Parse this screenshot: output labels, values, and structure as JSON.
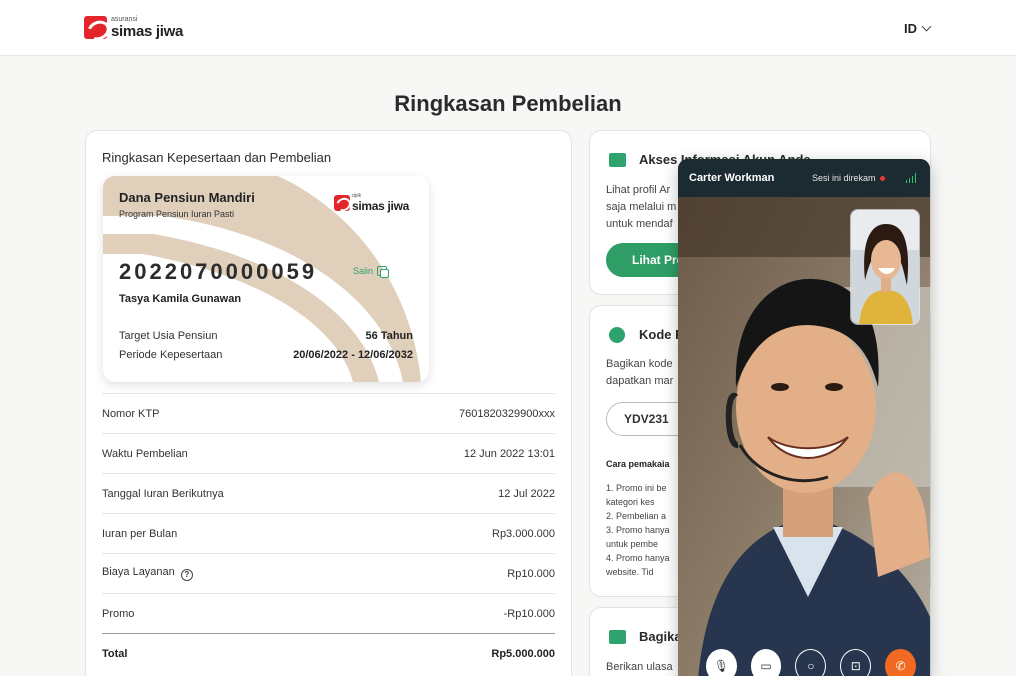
{
  "header": {
    "logo_sub": "asuransi",
    "logo_main": "simas jiwa",
    "language": "ID"
  },
  "page_title": "Ringkasan Pembelian",
  "summary": {
    "heading": "Ringkasan Kepesertaan dan Pembelian",
    "card": {
      "product_name": "Dana Pensiun Mandiri",
      "program": "Program Pensiun Iuran Pasti",
      "logo_sub": "dplk",
      "logo_main": "simas jiwa",
      "number": "2022070000059",
      "copy_label": "Salin",
      "holder": "Tasya Kamila Gunawan",
      "target_label": "Target Usia Pensiun",
      "target_value": "56 Tahun",
      "period_label": "Periode Kepesertaan",
      "period_value": "20/06/2022 - 12/06/2032"
    },
    "rows": [
      {
        "label": "Nomor KTP",
        "value": "7601820329900xxx"
      },
      {
        "label": "Waktu Pembelian",
        "value": "12 Jun 2022 13:01"
      },
      {
        "label": "Tanggal Iuran Berikutnya",
        "value": "12 Jul 2022"
      },
      {
        "label": "Iuran per Bulan",
        "value": "Rp3.000.000"
      },
      {
        "label": "Biaya Layanan",
        "value": "Rp10.000"
      },
      {
        "label": "Promo",
        "value": "-Rp10.000"
      },
      {
        "label": "Total",
        "value": "Rp5.000.000"
      }
    ]
  },
  "account_card": {
    "title": "Akses Informasi Akun Anda",
    "text_lines": [
      "Lihat profil Ar",
      "saja melalui m",
      "untuk mendaf"
    ],
    "button": "Lihat Pro"
  },
  "referral_card": {
    "title": "Kode F",
    "text_lines": [
      "Bagikan kode",
      "dapatkan mar"
    ],
    "code": "YDV231",
    "how_title": "Cara pemakaia",
    "steps": [
      "1. Promo ini be",
      "    kategori kes",
      "2. Pembelian a",
      "3. Promo hanya",
      "    untuk pembe",
      "4. Promo hanya",
      "    website. Tid"
    ]
  },
  "share_card": {
    "title": "Bagika",
    "text": "Berikan ulasa"
  },
  "video_call": {
    "agent_name": "Carter Workman",
    "recording_label": "Sesi ini direkam"
  },
  "colors": {
    "brand_red": "#e4262c",
    "accent_green": "#2e9e66",
    "end_call_orange": "#f26a22"
  }
}
